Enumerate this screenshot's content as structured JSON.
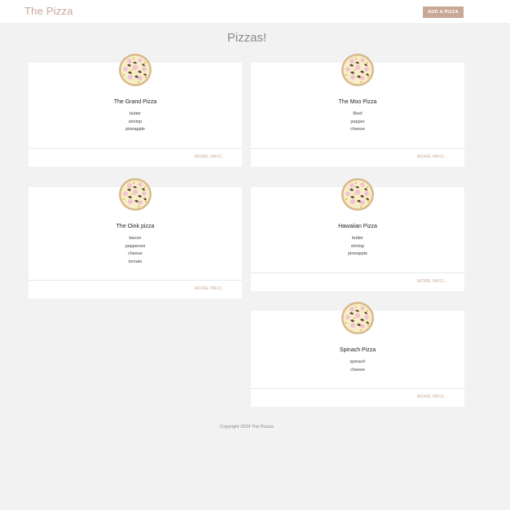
{
  "navbar": {
    "brand": "The Pizza",
    "add_button": "ADD A PIZZA"
  },
  "page": {
    "title": "Pizzas!"
  },
  "cards": [
    {
      "name": "The Grand Pizza",
      "ingredients": [
        "butter",
        "shrimp",
        "pineapple"
      ],
      "more": "MORE INFO..."
    },
    {
      "name": "The Moo Pizza",
      "ingredients": [
        "Beef",
        "pepper",
        "cheese"
      ],
      "more": "MORE INFO..."
    },
    {
      "name": "The Oink pizza",
      "ingredients": [
        "bacon",
        "pepperoni",
        "cheese",
        "tomato"
      ],
      "more": "MORE INFO..."
    },
    {
      "name": "Hawaiian Pizza",
      "ingredients": [
        "butter",
        "shrimp",
        "pineapple"
      ],
      "more": "MORE INFO..."
    },
    {
      "name": "Spinach Pizza",
      "ingredients": [
        "spinach",
        "cheese"
      ],
      "more": "MORE INFO..."
    }
  ],
  "footer": {
    "copyright": "Copyright 2024 The Pizzas"
  },
  "colors": {
    "accent": "#c9a795",
    "background": "#f2f2f2",
    "card": "#ffffff"
  },
  "icons": {
    "pizza": "pizza-icon"
  }
}
